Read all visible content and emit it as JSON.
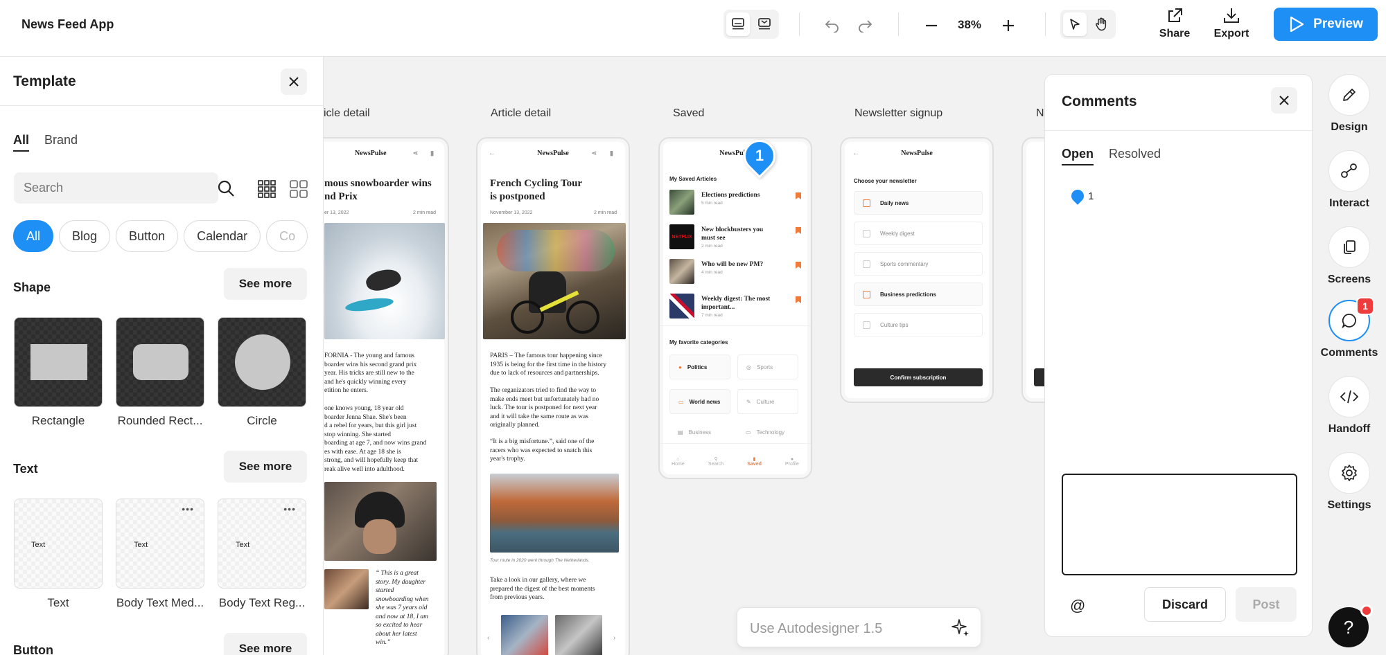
{
  "topbar": {
    "app_title": "News Feed App",
    "zoom": "38%",
    "share_label": "Share",
    "export_label": "Export",
    "preview_label": "Preview",
    "accent": "#1e90f5"
  },
  "left_panel": {
    "title": "Template",
    "tabs": [
      "All",
      "Brand"
    ],
    "search_placeholder": "Search",
    "chips": [
      "All",
      "Blog",
      "Button",
      "Calendar",
      "Co"
    ],
    "shape_section": "Shape",
    "text_section": "Text",
    "button_section": "Button",
    "see_more": "See more",
    "shapes": [
      "Rectangle",
      "Rounded Rect...",
      "Circle"
    ],
    "texts": [
      "Text",
      "Body Text Med...",
      "Body Text Reg..."
    ],
    "text_card_content": "Text",
    "dots": "•••"
  },
  "canvas": {
    "frame_labels": [
      "icle detail",
      "Article detail",
      "Saved",
      "Newsletter signup",
      "N"
    ],
    "brand": "NewsPulse",
    "frame1": {
      "title": "mous snowboarder wins\nnd Prix",
      "date": "er 13, 2022",
      "read": "2 min read",
      "body1": "FORNIA - The young and famous\nboarder wins his second grand prix\nyear. His tricks are still new to the\nand he's quickly winning every\netition he enters.",
      "body2": "one knows young, 18 year old\nboarder Jenna Shae. She's been\nd a rebel for years, but this girl just\nstop winning. She started\nboarding at age 7, and now wins grand\nes with ease. At age 18 she is\nstrong, and will hopefully keep that\nreak alive well into adulthood.",
      "quote": "“ This is a great\nstory. My daughter\nstarted\nsnowboarding when\nshe was 7 years old\nand now at 18, I am\nso excited to hear\nabout her latest\nwin.”"
    },
    "frame2": {
      "title": "French Cycling Tour\nis postponed",
      "date": "November 13, 2022",
      "read": "2 min read",
      "body1": "PARIS – The famous tour happening since\n1935 is being for the first time in the history\ndue to lack of resources and partnerships.",
      "body2": "The organizators tried to find the way to\nmake ends meet but unfortunately had no\nluck. The tour is postponed for next year\nand it will take the same route as was\noriginally planned.",
      "body3": "“It is a big misfortune.”, said one of the\nracers who was expected to snatch this\nyear's trophy.",
      "caption": "Tour route in 2020 went through The Netherlands.",
      "body4": "Take a look in our gallery, where we\nprepared the digest of the best moments\nfrom previous years."
    },
    "frame3": {
      "heading": "My Saved Articles",
      "articles": [
        {
          "title": "Elections predictions",
          "meta": "5 min read"
        },
        {
          "title": "New blockbusters you\nmust see",
          "meta": "2 min read"
        },
        {
          "title": "Who will be new PM?",
          "meta": "4 min read"
        },
        {
          "title": "Weekly digest: The most\nimportant...",
          "meta": "7 min read"
        }
      ],
      "cat_heading": "My favorite categories",
      "categories": [
        "Politics",
        "Sports",
        "World news",
        "Culture",
        "Business",
        "Technology"
      ],
      "nav": [
        "Home",
        "Search",
        "Saved",
        "Profile"
      ]
    },
    "frame4": {
      "heading": "Choose your newsletter",
      "options": [
        "Daily news",
        "Weekly digest",
        "Sports commentary",
        "Business predictions",
        "Culture tips"
      ],
      "confirm": "Confirm subscription"
    },
    "marker": "1"
  },
  "comments": {
    "title": "Comments",
    "tabs": [
      "Open",
      "Resolved"
    ],
    "thread_number": "1",
    "at_symbol": "@",
    "discard": "Discard",
    "post": "Post"
  },
  "rail": {
    "items": [
      "Design",
      "Interact",
      "Screens",
      "Comments",
      "Handoff",
      "Settings"
    ],
    "comments_badge": "1"
  },
  "autodesigner": {
    "placeholder": "Use Autodesigner 1.5"
  },
  "help": "?"
}
